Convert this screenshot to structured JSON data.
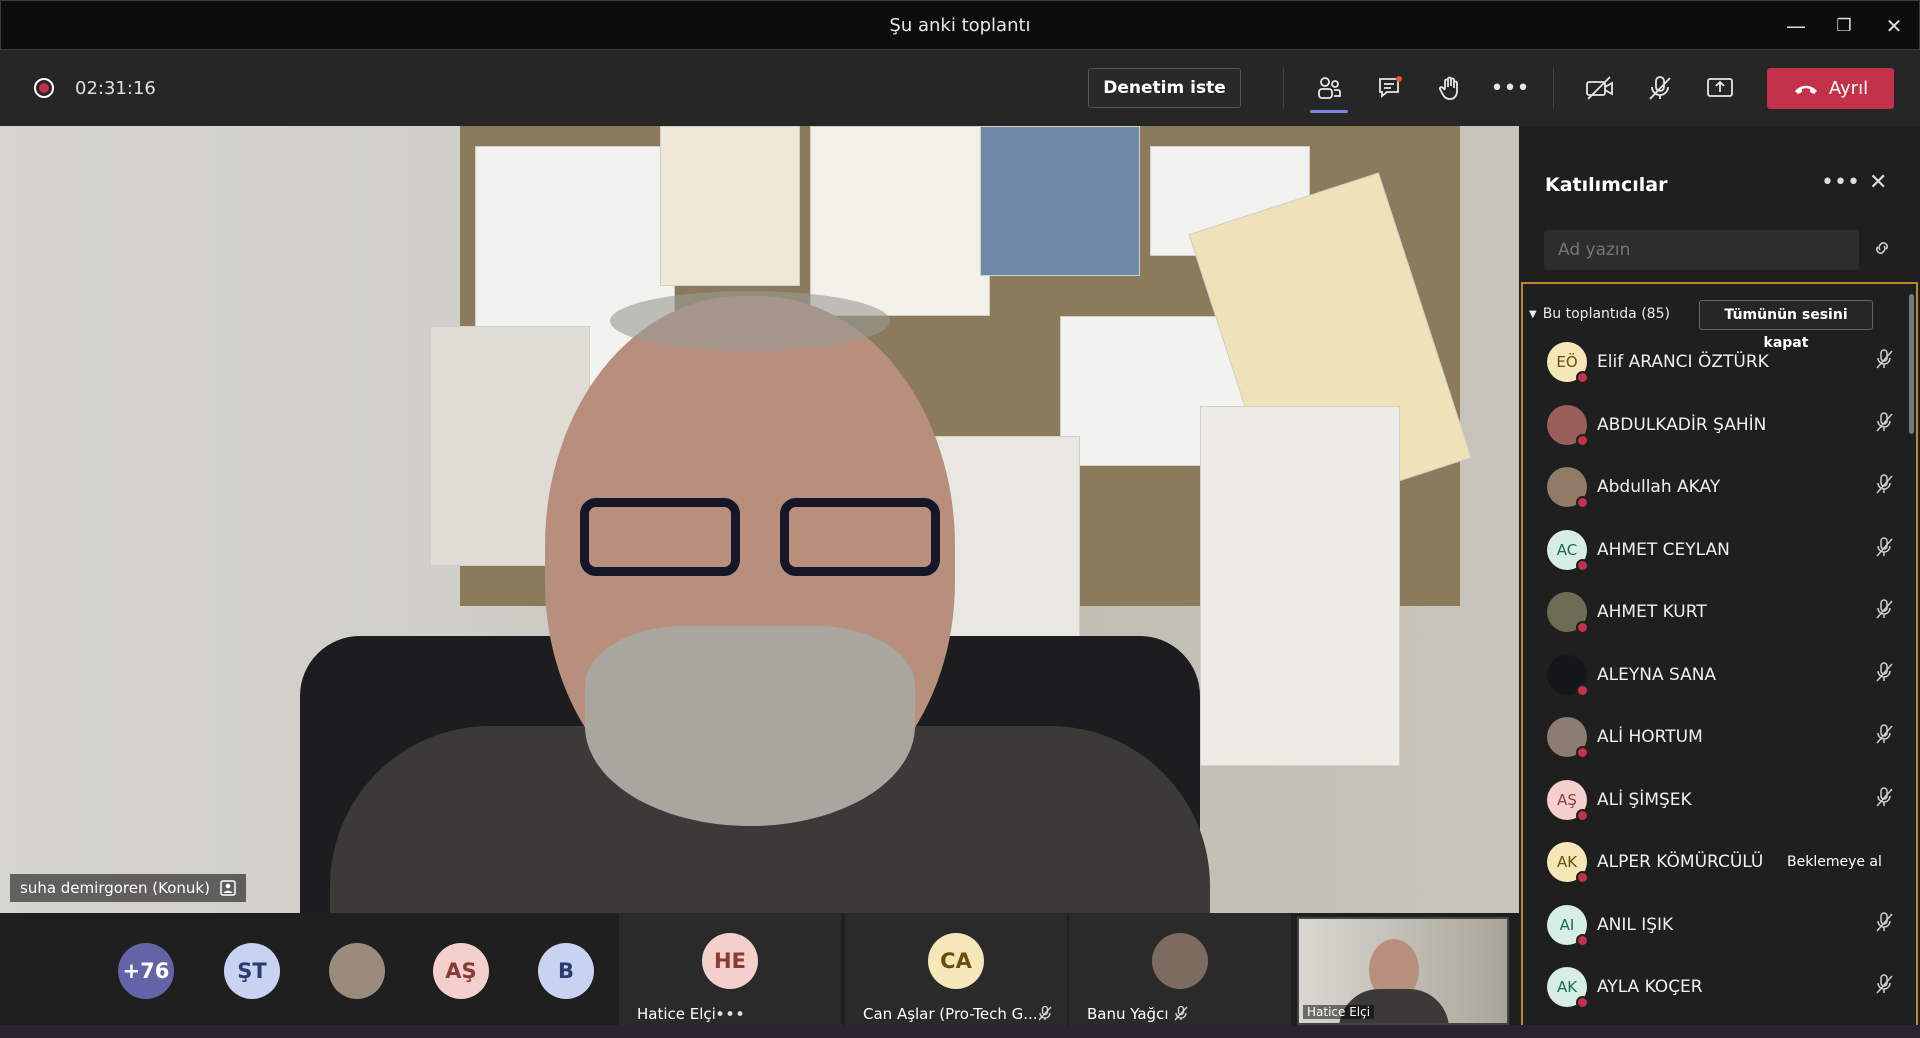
{
  "window": {
    "title": "Şu anki toplantı"
  },
  "toolbar": {
    "timer": "02:31:16",
    "control_label": "Denetim iste",
    "leave_label": "Ayrıl"
  },
  "main_video": {
    "participant_name": "suha demirgoren (Konuk)"
  },
  "gallery": {
    "overflow_count": "+76",
    "avatars": [
      {
        "initials": "ŞT",
        "color": "#c7d3f0"
      },
      {
        "initials": "",
        "color": "#9a8b7c"
      },
      {
        "initials": "AŞ",
        "color": "#f3d0cc"
      },
      {
        "initials": "B",
        "color": "#c7d3f0"
      }
    ],
    "tiles": [
      {
        "initials": "HE",
        "name": "Hatice Elçi",
        "color": "#f3d0cc",
        "text_color": "#8a3b35"
      },
      {
        "initials": "CA",
        "name": "Can Aşlar (Pro-Tech G...",
        "color": "#f6e7b8",
        "text_color": "#6b4c0a"
      },
      {
        "initials": "",
        "name": "Banu Yağcı",
        "color": "#7e6b5f",
        "text_color": "#ffffff"
      }
    ],
    "self_name": "Hatice Elçi"
  },
  "panel": {
    "title": "Katılımcılar",
    "search_placeholder": "Ad yazın",
    "section_label": "Bu toplantıda (85)",
    "mute_all_label": "Tümünün sesini kapat",
    "participants": [
      {
        "initials": "EÖ",
        "name": "Elif ARANCI ÖZTÜRK",
        "color": "#f6e7b8",
        "text_color": "#6b4c0a",
        "action": ""
      },
      {
        "initials": "",
        "name": "ABDULKADİR ŞAHİN",
        "color": "#9b5f5a",
        "text_color": "#ffffff",
        "action": ""
      },
      {
        "initials": "",
        "name": "Abdullah AKAY",
        "color": "#8f7b66",
        "text_color": "#ffffff",
        "action": ""
      },
      {
        "initials": "AC",
        "name": "AHMET CEYLAN",
        "color": "#d6eee4",
        "text_color": "#216a4a",
        "action": ""
      },
      {
        "initials": "",
        "name": "AHMET KURT",
        "color": "#6e6b54",
        "text_color": "#ffffff",
        "action": ""
      },
      {
        "initials": "",
        "name": "ALEYNA SANA",
        "color": "#15161a",
        "text_color": "#ffffff",
        "action": ""
      },
      {
        "initials": "",
        "name": "ALİ HORTUM",
        "color": "#8c7c71",
        "text_color": "#ffffff",
        "action": ""
      },
      {
        "initials": "AŞ",
        "name": "ALİ ŞİMŞEK",
        "color": "#f3d0cc",
        "text_color": "#8a3b35",
        "action": ""
      },
      {
        "initials": "AK",
        "name": "ALPER KÖMÜRCÜLÜ",
        "color": "#f6e7b8",
        "text_color": "#6b4c0a",
        "action": "Beklemeye al"
      },
      {
        "initials": "AI",
        "name": "ANIL IŞIK",
        "color": "#d6eee4",
        "text_color": "#216a4a",
        "action": ""
      },
      {
        "initials": "AK",
        "name": "AYLA KOÇER",
        "color": "#d6eee4",
        "text_color": "#216a4a",
        "action": ""
      }
    ]
  },
  "colors": {
    "leave": "#c4314b",
    "accent": "#7b83eb",
    "section_border": "#b68a2f"
  }
}
